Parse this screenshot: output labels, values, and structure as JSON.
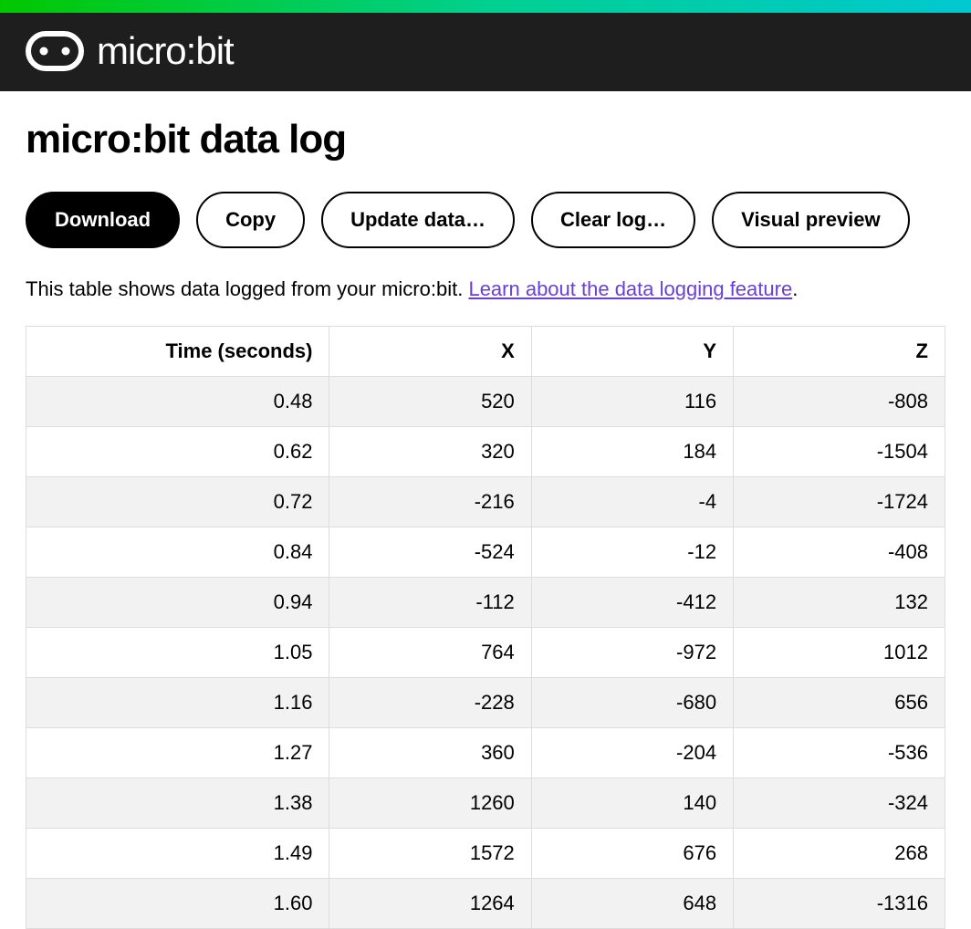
{
  "brand": {
    "name": "micro:bit"
  },
  "page": {
    "title": "micro:bit data log",
    "description_text": "This table shows data logged from your micro:bit. ",
    "learn_link_text": "Learn about the data logging feature",
    "description_suffix": "."
  },
  "buttons": {
    "download": "Download",
    "copy": "Copy",
    "update": "Update data…",
    "clear": "Clear log…",
    "preview": "Visual preview"
  },
  "table": {
    "headers": [
      "Time (seconds)",
      "X",
      "Y",
      "Z"
    ],
    "rows": [
      [
        "0.48",
        "520",
        "116",
        "-808"
      ],
      [
        "0.62",
        "320",
        "184",
        "-1504"
      ],
      [
        "0.72",
        "-216",
        "-4",
        "-1724"
      ],
      [
        "0.84",
        "-524",
        "-12",
        "-408"
      ],
      [
        "0.94",
        "-112",
        "-412",
        "132"
      ],
      [
        "1.05",
        "764",
        "-972",
        "1012"
      ],
      [
        "1.16",
        "-228",
        "-680",
        "656"
      ],
      [
        "1.27",
        "360",
        "-204",
        "-536"
      ],
      [
        "1.38",
        "1260",
        "140",
        "-324"
      ],
      [
        "1.49",
        "1572",
        "676",
        "268"
      ],
      [
        "1.60",
        "1264",
        "648",
        "-1316"
      ]
    ]
  }
}
